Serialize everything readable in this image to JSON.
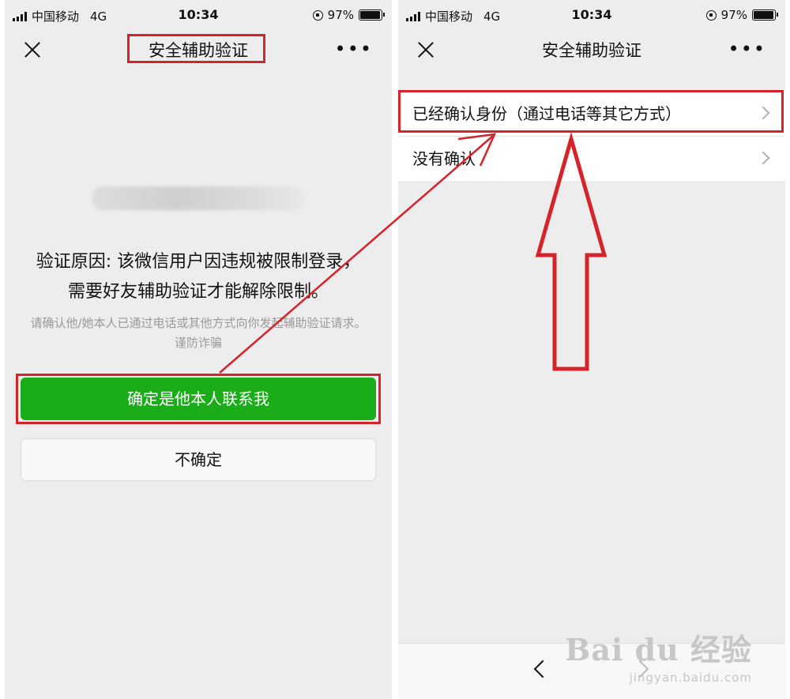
{
  "left": {
    "status": {
      "carrier": "中国移动",
      "network": "4G",
      "time": "10:34",
      "battery": "97%"
    },
    "navbar": {
      "title": "安全辅助验证",
      "more": "•••"
    },
    "reason_text": "验证原因: 该微信用户因违规被限制登录，需要好友辅助验证才能解除限制。",
    "note_text": "请确认他/她本人已通过电话或其他方式向你发起辅助验证请求。谨防诈骗",
    "confirm_button": "确定是他本人联系我",
    "unsure_button": "不确定"
  },
  "right": {
    "status": {
      "carrier": "中国移动",
      "network": "4G",
      "time": "10:34",
      "battery": "97%"
    },
    "navbar": {
      "title": "安全辅助验证",
      "more": "•••"
    },
    "options": [
      {
        "label": "已经确认身份（通过电话等其它方式）"
      },
      {
        "label": "没有确认"
      }
    ]
  },
  "watermark": {
    "brand": "Bai du 经验",
    "url": "jingyan.baidu.com"
  },
  "colors": {
    "accent_green": "#1aad19",
    "highlight_red": "#d5232a",
    "page_bg": "#ededed"
  }
}
